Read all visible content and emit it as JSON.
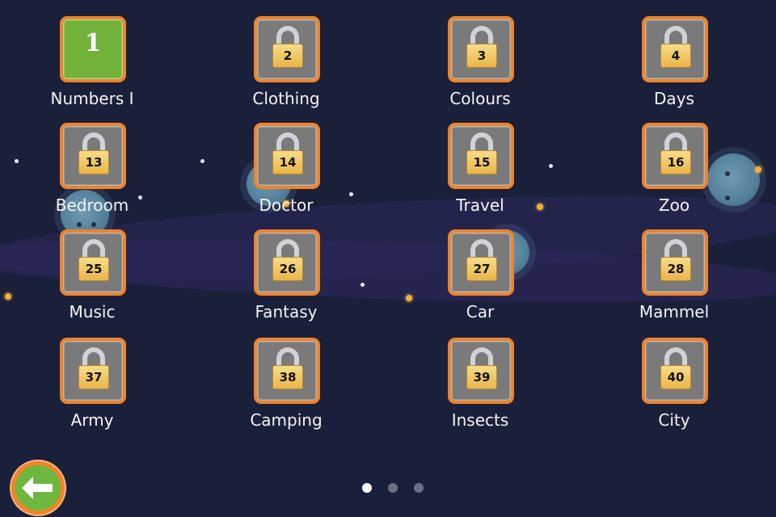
{
  "colors": {
    "background": "#1a1f3a",
    "tile_border": "#f0832a",
    "tile_locked": "#7a7a7a",
    "tile_unlocked": "#72b23a",
    "back_button": "#6db73e"
  },
  "levels": [
    {
      "number": "1",
      "label": "Numbers I",
      "locked": false
    },
    {
      "number": "2",
      "label": "Clothing",
      "locked": true
    },
    {
      "number": "3",
      "label": "Colours",
      "locked": true
    },
    {
      "number": "4",
      "label": "Days",
      "locked": true
    },
    {
      "number": "13",
      "label": "Bedroom",
      "locked": true
    },
    {
      "number": "14",
      "label": "Doctor",
      "locked": true
    },
    {
      "number": "15",
      "label": "Travel",
      "locked": true
    },
    {
      "number": "16",
      "label": "Zoo",
      "locked": true
    },
    {
      "number": "25",
      "label": "Music",
      "locked": true
    },
    {
      "number": "26",
      "label": "Fantasy",
      "locked": true
    },
    {
      "number": "27",
      "label": "Car",
      "locked": true
    },
    {
      "number": "28",
      "label": "Mammel",
      "locked": true
    },
    {
      "number": "37",
      "label": "Army",
      "locked": true
    },
    {
      "number": "38",
      "label": "Camping",
      "locked": true
    },
    {
      "number": "39",
      "label": "Insects",
      "locked": true
    },
    {
      "number": "40",
      "label": "City",
      "locked": true
    }
  ],
  "pagination": {
    "pages": 3,
    "current": 1
  },
  "back_button": {
    "icon": "arrow-left-icon"
  }
}
